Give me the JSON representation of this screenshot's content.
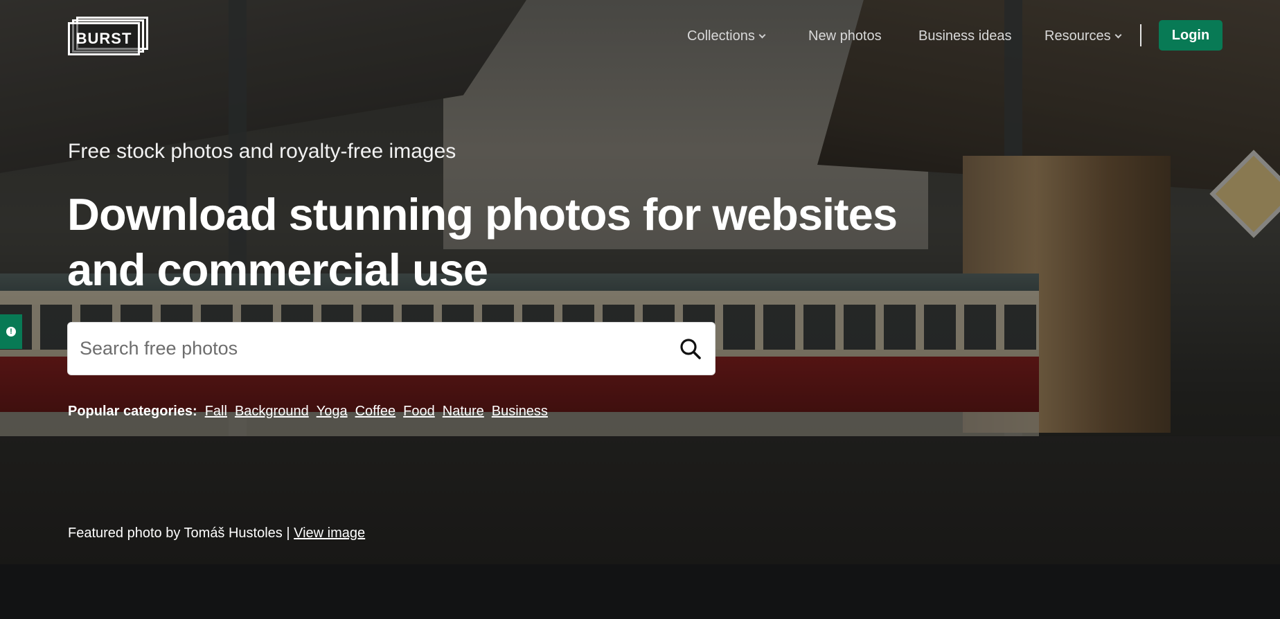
{
  "brand": {
    "logo_text": "BURST"
  },
  "nav": {
    "collections": "Collections",
    "new_photos": "New photos",
    "business_ideas": "Business ideas",
    "resources": "Resources",
    "login": "Login"
  },
  "hero": {
    "kicker": "Free stock photos and royalty-free images",
    "headline": "Download stunning photos for websites and commercial use"
  },
  "search": {
    "placeholder": "Search free photos",
    "value": "",
    "icon": "search-icon"
  },
  "popular": {
    "label": "Popular categories:",
    "items": [
      "Fall",
      "Background",
      "Yoga",
      "Coffee",
      "Food",
      "Nature",
      "Business"
    ]
  },
  "credit": {
    "text": "Featured photo by Tomáš Hustoles |",
    "link": "View image"
  },
  "feedback": {
    "icon": "feedback-icon",
    "glyph": "!"
  },
  "colors": {
    "accent": "#087a55",
    "page_bg": "#121314",
    "text": "#ffffff"
  }
}
